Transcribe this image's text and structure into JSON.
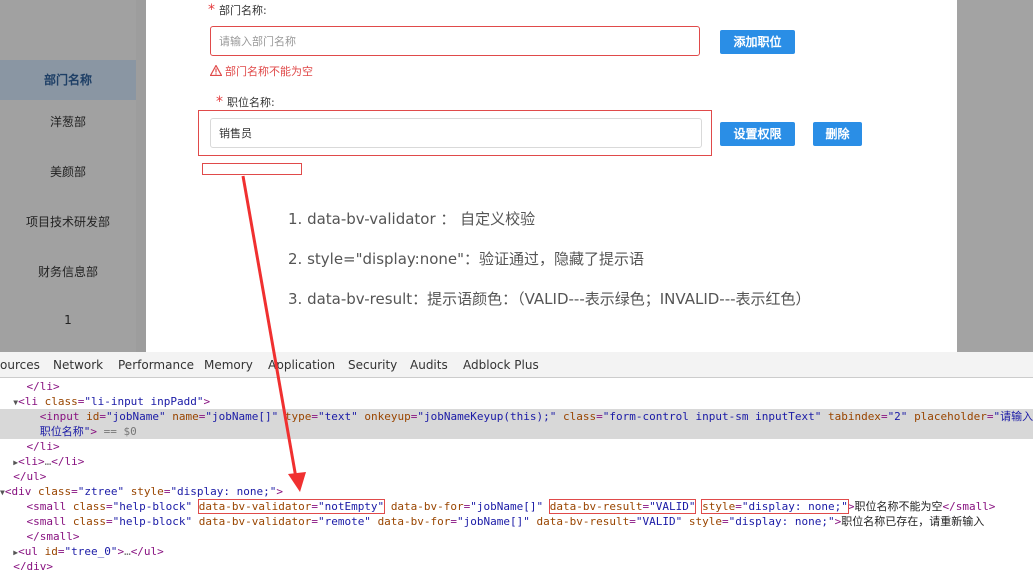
{
  "sidebar": {
    "header": "部门名称",
    "departments": [
      "洋葱部",
      "美颜部",
      "项目技术研发部",
      "财务信息部",
      "1"
    ]
  },
  "form": {
    "dept_label": "部门名称:",
    "dept_placeholder": "请输入部门名称",
    "dept_error": "部门名称不能为空",
    "add_job_button": "添加职位",
    "job_label": "职位名称:",
    "job_value": "销售员",
    "set_permission_button": "设置权限",
    "delete_button": "删除"
  },
  "notes": [
    "1. data-bv-validator ： 自定义校验",
    "2. style=\"display:none\"：验证通过，隐藏了提示语",
    "3. data-bv-result：提示语颜色：（VALID---表示绿色；INVALID---表示红色）"
  ],
  "devtools": {
    "tabs": [
      "ources",
      "Network",
      "Performance",
      "Memory",
      "Application",
      "Security",
      "Audits",
      "Adblock Plus"
    ],
    "code": {
      "l1": "</li>",
      "l2_tag": "<li",
      "l2_attr": "class",
      "l2_val": "\"li-input inpPadd\"",
      "l2_end": ">",
      "l3_tag": "<input",
      "l3_a1": "id",
      "l3_v1": "\"jobName\"",
      "l3_a2": "name",
      "l3_v2": "\"jobName[]\"",
      "l3_a3": "type",
      "l3_v3": "\"text\"",
      "l3_a4": "onkeyup",
      "l3_v4": "\"jobNameKeyup(this);\"",
      "l3_a5": "class",
      "l3_v5": "\"form-control input-sm inputText\"",
      "l3_a6": "tabindex",
      "l3_v6": "\"2\"",
      "l3_a7": "placeholder",
      "l3_v7": "\"请输入",
      "l4_val": "职位名称\"",
      "l4_end": ">",
      "l4_eq": " == $0",
      "l5": "</li>",
      "l6_open": "<li>",
      "l6_ell": "…",
      "l6_close": "</li>",
      "l7": "</ul>",
      "l8_tag": "<div",
      "l8_a1": "class",
      "l8_v1": "\"ztree\"",
      "l8_a2": "style",
      "l8_v2": "\"display: none;\"",
      "l8_end": ">",
      "l9_tag": "<small",
      "l9_a1": "class",
      "l9_v1": "\"help-block\"",
      "l9_a2": "data-bv-validator",
      "l9_v2": "\"notEmpty\"",
      "l9_a3": "data-bv-for",
      "l9_v3": "\"jobName[]\"",
      "l9_a4": "data-bv-result",
      "l9_v4": "\"VALID\"",
      "l9_a5": "style",
      "l9_v5": "\"display: none;\"",
      "l9_text": "职位名称不能为空",
      "l9_close": "</small>",
      "l10_tag": "<small",
      "l10_a1": "class",
      "l10_v1": "\"help-block\"",
      "l10_a2": "data-bv-validator",
      "l10_v2": "\"remote\"",
      "l10_a3": "data-bv-for",
      "l10_v3": "\"jobName[]\"",
      "l10_a4": "data-bv-result",
      "l10_v4": "\"VALID\"",
      "l10_a5": "style",
      "l10_v5": "\"display: none;\"",
      "l10_text": "职位名称已存在，请重新输入",
      "l11": "</small>",
      "l12_tag": "<ul",
      "l12_a1": "id",
      "l12_v1": "\"tree_0\"",
      "l12_end": ">",
      "l12_ell": "…",
      "l12_close": "</ul>",
      "l13": "</div>"
    }
  },
  "colors": {
    "primary_button": "#2a8ee6",
    "error_red": "#e04a4a",
    "sidebar_header_text": "#1e3f66"
  }
}
